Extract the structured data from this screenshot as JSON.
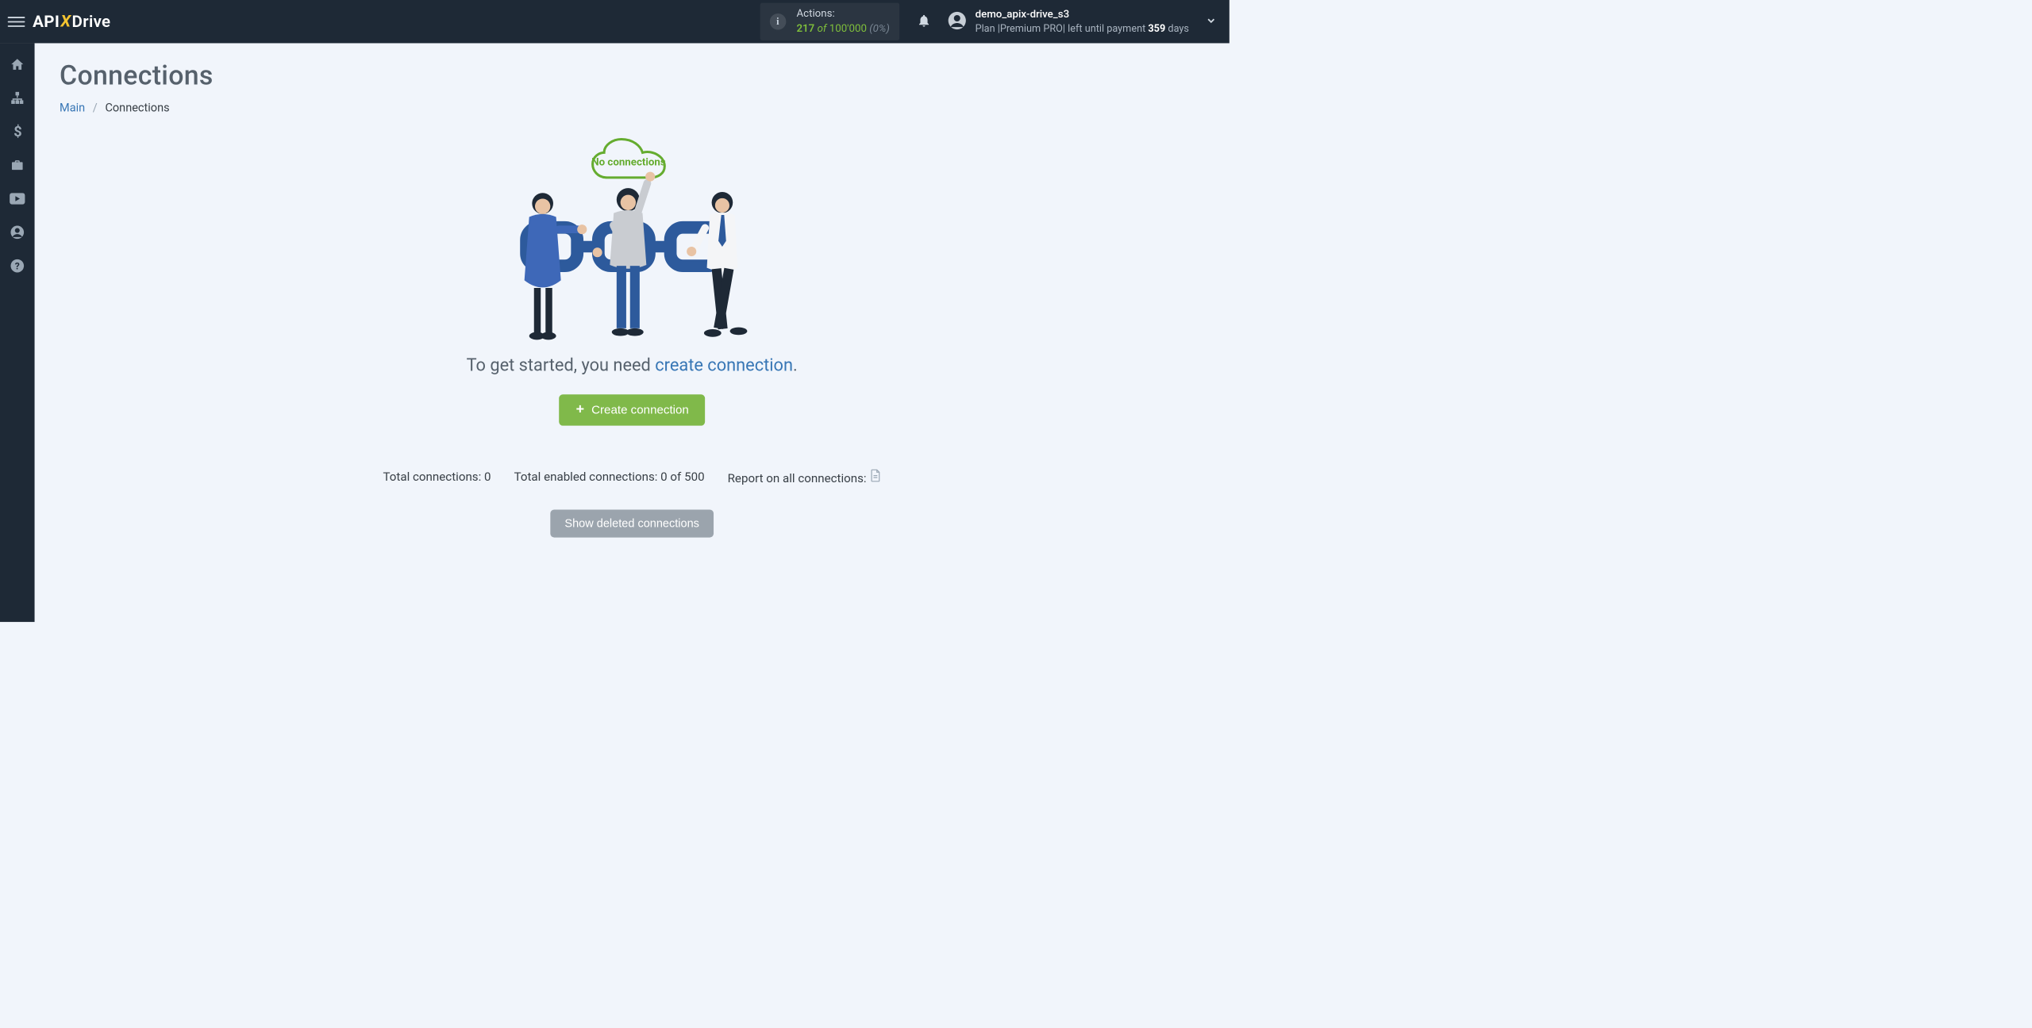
{
  "header": {
    "actions": {
      "label": "Actions:",
      "used": "217",
      "of": "of",
      "total": "100'000",
      "percent": "(0%)"
    },
    "user": {
      "name": "demo_apix-drive_s3",
      "plan_prefix": "Plan |",
      "plan_name": "Premium PRO",
      "plan_suffix": "| left until payment ",
      "days": "359",
      "days_word": " days"
    }
  },
  "sidebar": {
    "items": [
      "home",
      "sitemap",
      "dollar",
      "briefcase",
      "youtube",
      "user",
      "help"
    ]
  },
  "page": {
    "title": "Connections",
    "breadcrumb_main": "Main",
    "breadcrumb_current": "Connections"
  },
  "empty": {
    "cloud_text": "No connections",
    "prompt_before": "To get started, you need ",
    "prompt_link": "create connection",
    "prompt_after": ".",
    "create_button": "Create connection",
    "total_connections_label": "Total connections: ",
    "total_connections_value": "0",
    "enabled_label": "Total enabled connections: ",
    "enabled_value": "0 of 500",
    "report_label": "Report on all connections: ",
    "show_deleted": "Show deleted connections"
  }
}
